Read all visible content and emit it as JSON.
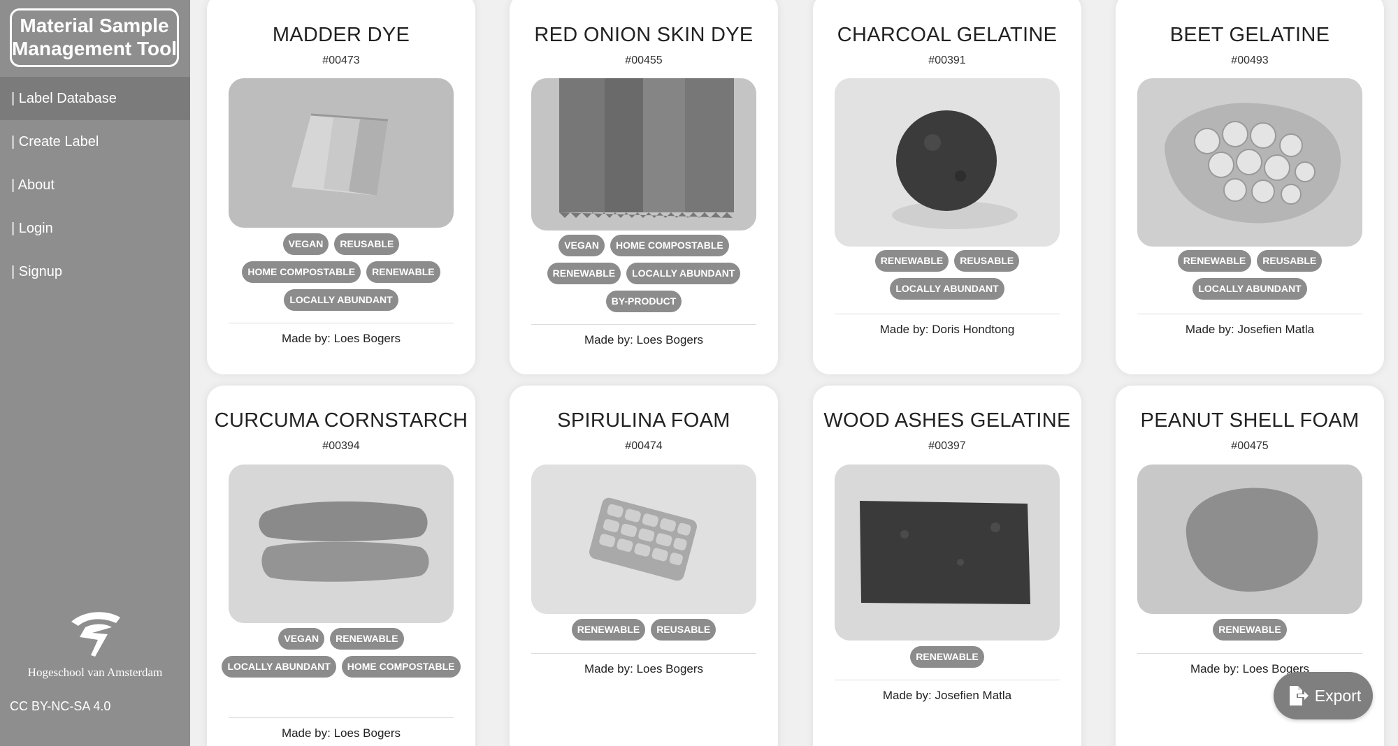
{
  "app": {
    "title": "Material Sample Management Tool"
  },
  "sidebar": {
    "items": [
      {
        "label": "| Label Database"
      },
      {
        "label": "| Create Label"
      },
      {
        "label": "| About"
      },
      {
        "label": "| Login"
      },
      {
        "label": "| Signup"
      }
    ],
    "institution": "Hogeschool van Amsterdam",
    "license": "CC BY-NC-SA 4.0"
  },
  "cards": [
    {
      "title": "MADDER DYE",
      "id": "#00473",
      "tags": [
        "VEGAN",
        "REUSABLE",
        "HOME COMPOSTABLE",
        "RENEWABLE",
        "LOCALLY ABUNDANT"
      ],
      "maker": "Made by: Loes Bogers"
    },
    {
      "title": "RED ONION SKIN DYE",
      "id": "#00455",
      "tags": [
        "VEGAN",
        "HOME COMPOSTABLE",
        "RENEWABLE",
        "LOCALLY ABUNDANT",
        "BY-PRODUCT"
      ],
      "maker": "Made by: Loes Bogers"
    },
    {
      "title": "CHARCOAL GELATINE",
      "id": "#00391",
      "tags": [
        "RENEWABLE",
        "REUSABLE",
        "LOCALLY ABUNDANT"
      ],
      "maker": "Made by: Doris Hondtong"
    },
    {
      "title": "BEET GELATINE",
      "id": "#00493",
      "tags": [
        "RENEWABLE",
        "REUSABLE",
        "LOCALLY ABUNDANT"
      ],
      "maker": "Made by: Josefien Matla"
    },
    {
      "title": "CURCUMA CORNSTARCH",
      "id": "#00394",
      "tags": [
        "VEGAN",
        "RENEWABLE",
        "LOCALLY ABUNDANT",
        "HOME COMPOSTABLE"
      ],
      "maker": "Made by: Loes Bogers"
    },
    {
      "title": "SPIRULINA FOAM",
      "id": "#00474",
      "tags": [
        "RENEWABLE",
        "REUSABLE"
      ],
      "maker": "Made by: Loes Bogers"
    },
    {
      "title": "WOOD ASHES GELATINE",
      "id": "#00397",
      "tags": [
        "RENEWABLE"
      ],
      "maker": "Made by: Josefien Matla"
    },
    {
      "title": "PEANUT SHELL FOAM",
      "id": "#00475",
      "tags": [
        "RENEWABLE"
      ],
      "maker": "Made by: Loes Bogers"
    }
  ],
  "export": {
    "label": "Export"
  }
}
